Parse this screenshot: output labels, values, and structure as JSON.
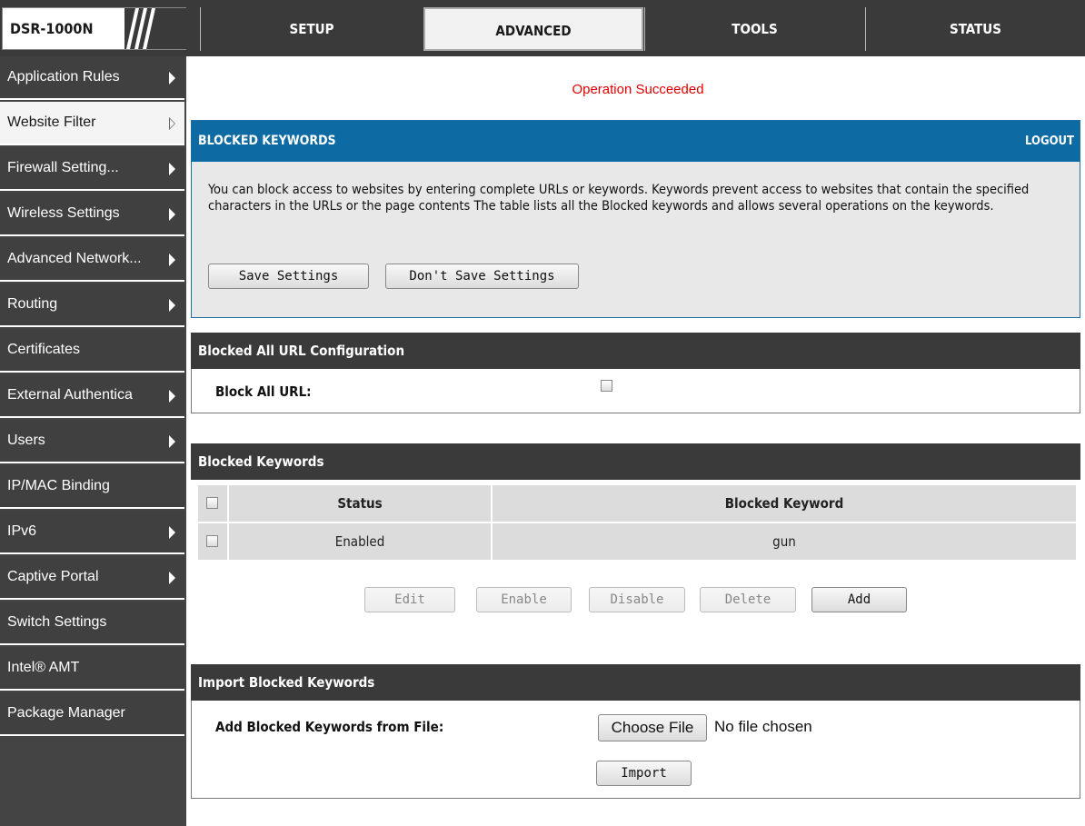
{
  "brand": {
    "model": "DSR-1000N"
  },
  "tabs": [
    {
      "label": "SETUP",
      "active": false
    },
    {
      "label": "ADVANCED",
      "active": true
    },
    {
      "label": "TOOLS",
      "active": false
    },
    {
      "label": "STATUS",
      "active": false
    }
  ],
  "sidebar": {
    "items": [
      {
        "label": "Application Rules",
        "has_arrow": true
      },
      {
        "label": "Website Filter",
        "has_arrow": true,
        "selected": true
      },
      {
        "label": "Firewall Setting...",
        "has_arrow": true
      },
      {
        "label": "Wireless Settings",
        "has_arrow": true
      },
      {
        "label": "Advanced Network...",
        "has_arrow": true
      },
      {
        "label": "Routing",
        "has_arrow": true
      },
      {
        "label": "Certificates",
        "has_arrow": false
      },
      {
        "label": "External Authentica",
        "has_arrow": true
      },
      {
        "label": "Users",
        "has_arrow": true
      },
      {
        "label": "IP/MAC Binding",
        "has_arrow": false
      },
      {
        "label": "IPv6",
        "has_arrow": true
      },
      {
        "label": "Captive Portal",
        "has_arrow": true
      },
      {
        "label": "Switch Settings",
        "has_arrow": false
      },
      {
        "label": "Intel® AMT",
        "has_arrow": false
      },
      {
        "label": "Package Manager",
        "has_arrow": false
      }
    ]
  },
  "status_message": "Operation Succeeded",
  "colors": {
    "status_red": "#e00000",
    "panel_blue": "#0d6aa3",
    "header_dark": "#3a3a3a"
  },
  "blocked_panel": {
    "title": "BLOCKED KEYWORDS",
    "logout": "LOGOUT",
    "description": "You can block access to websites by entering complete URLs or keywords. Keywords prevent access to websites that contain the specified characters in the URLs or the page contents The table lists all the Blocked keywords and allows several operations on the keywords.",
    "save_label": "Save Settings",
    "dont_save_label": "Don't Save Settings"
  },
  "block_all": {
    "title": "Blocked All URL Configuration",
    "label": "Block All URL:",
    "checked": false
  },
  "keywords": {
    "title": "Blocked Keywords",
    "columns": [
      "Status",
      "Blocked Keyword"
    ],
    "rows": [
      {
        "status": "Enabled",
        "keyword": "gun",
        "checked": false
      }
    ],
    "actions": {
      "edit": "Edit",
      "enable": "Enable",
      "disable": "Disable",
      "delete": "Delete",
      "add": "Add"
    }
  },
  "import": {
    "title": "Import Blocked Keywords",
    "label": "Add Blocked Keywords from File:",
    "choose_file": "Choose File",
    "file_status": "No file chosen",
    "import_label": "Import"
  }
}
